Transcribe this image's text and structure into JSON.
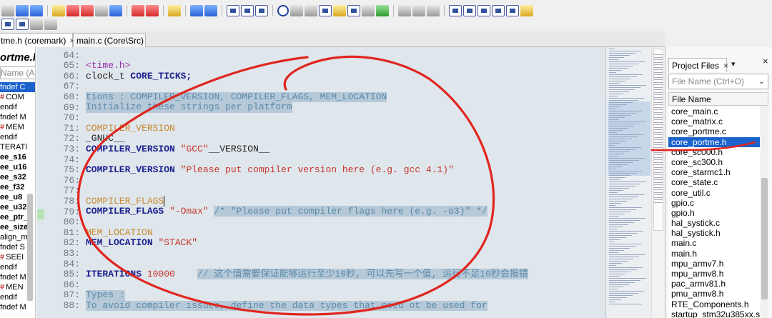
{
  "tabs": [
    {
      "label": "tme.h (coremark)",
      "close": "×"
    },
    {
      "label": "main.c (Core\\Src)"
    }
  ],
  "outline": {
    "title": "ortme.h",
    "search_placeholder": "Name (A",
    "items": [
      {
        "hash": "",
        "text": "fndef C"
      },
      {
        "hash": "#",
        "text": "COM"
      },
      {
        "hash": "",
        "text": "endif"
      },
      {
        "hash": "",
        "text": "fndef M"
      },
      {
        "hash": "#",
        "text": "MEM"
      },
      {
        "hash": "",
        "text": "endif"
      },
      {
        "hash": "",
        "text": "TERATI"
      },
      {
        "hash": "",
        "text": "ee_s16"
      },
      {
        "hash": "",
        "text": "ee_u16"
      },
      {
        "hash": "",
        "text": "ee_s32"
      },
      {
        "hash": "",
        "text": "ee_f32"
      },
      {
        "hash": "",
        "text": "ee_u8"
      },
      {
        "hash": "",
        "text": "ee_u32"
      },
      {
        "hash": "",
        "text": "ee_ptr_"
      },
      {
        "hash": "",
        "text": "ee_size"
      },
      {
        "hash": "",
        "text": "align_m"
      },
      {
        "hash": "",
        "text": "fndef S"
      },
      {
        "hash": "#",
        "text": "SEEI"
      },
      {
        "hash": "",
        "text": "endif"
      },
      {
        "hash": "",
        "text": "fndef M"
      },
      {
        "hash": "#",
        "text": "MEN"
      },
      {
        "hash": "",
        "text": "endif"
      },
      {
        "hash": "",
        "text": "fndef M"
      }
    ]
  },
  "code": {
    "line_numbers": [
      "64:",
      "65:",
      "66:",
      "67:",
      "68:",
      "69:",
      "70:",
      "71:",
      "72:",
      "73:",
      "74:",
      "75:",
      "76:",
      "77:",
      "78:",
      "79:",
      "80:",
      "81:",
      "82:",
      "83:",
      "84:",
      "85:",
      "86:",
      "87:",
      "88:"
    ],
    "l65": "<time.h>",
    "l66a": "clock_t",
    "l66b": " CORE_TICKS;",
    "l68": "tions : COMPILER_VERSION, COMPILER_FLAGS, MEM_LOCATION",
    "l69": "Initialize these strings per platform",
    "l71": "COMPILER_VERSION",
    "l72": "_GNUC__",
    "l73a": "COMPILER_VERSION",
    "l73b": "\"GCC\"",
    "l73c": "__VERSION__",
    "l75a": "COMPILER_VERSION",
    "l75b": "\"Please put compiler version here (e.g. gcc 4.1)\"",
    "l78": "COMPILER_FLAGS",
    "l79a": "COMPILER_FLAGS",
    "l79b": "\"-Omax\"",
    "l79c": "/* \"Please put compiler flags here (e.g. -o3)\" */",
    "l81": "MEM_LOCATION",
    "l82a": "MEM_LOCATION",
    "l82b": "\"STACK\"",
    "l85a": "ITERATIONS",
    "l85b": "10000",
    "l85c": "// 这个值需要保证能够运行至少10秒, 可以先写一个值, 运行不足10秒会报错",
    "l87": "Types :",
    "l88": "To avoid compiler issues, define the data types that need ot be used for"
  },
  "project_panel": {
    "tab_label": "Project Files",
    "tab_close": "×",
    "dropdown_glyph": "▾",
    "close_glyph": "×",
    "search_placeholder": "File Name (Ctrl+O)",
    "search_chevron": "⌄",
    "column_header": "File Name",
    "files": [
      "core_main.c",
      "core_matrix.c",
      "core_portme.c",
      "core_portme.h",
      "core_sc000.h",
      "core_sc300.h",
      "core_starmc1.h",
      "core_state.c",
      "core_util.c",
      "gpio.c",
      "gpio.h",
      "hal_systick.c",
      "hal_systick.h",
      "main.c",
      "main.h",
      "mpu_armv7.h",
      "mpu_armv8.h",
      "pac_armv81.h",
      "pmu_armv8.h",
      "RTE_Components.h",
      "startup_stm32u385xx.s"
    ],
    "selected_index": 3
  },
  "colors": {
    "selection": "#1a62cc",
    "keyword": "#1b1f8e",
    "string": "#c5372c",
    "macro": "#c88a2e",
    "annotation": "#e0261f"
  }
}
